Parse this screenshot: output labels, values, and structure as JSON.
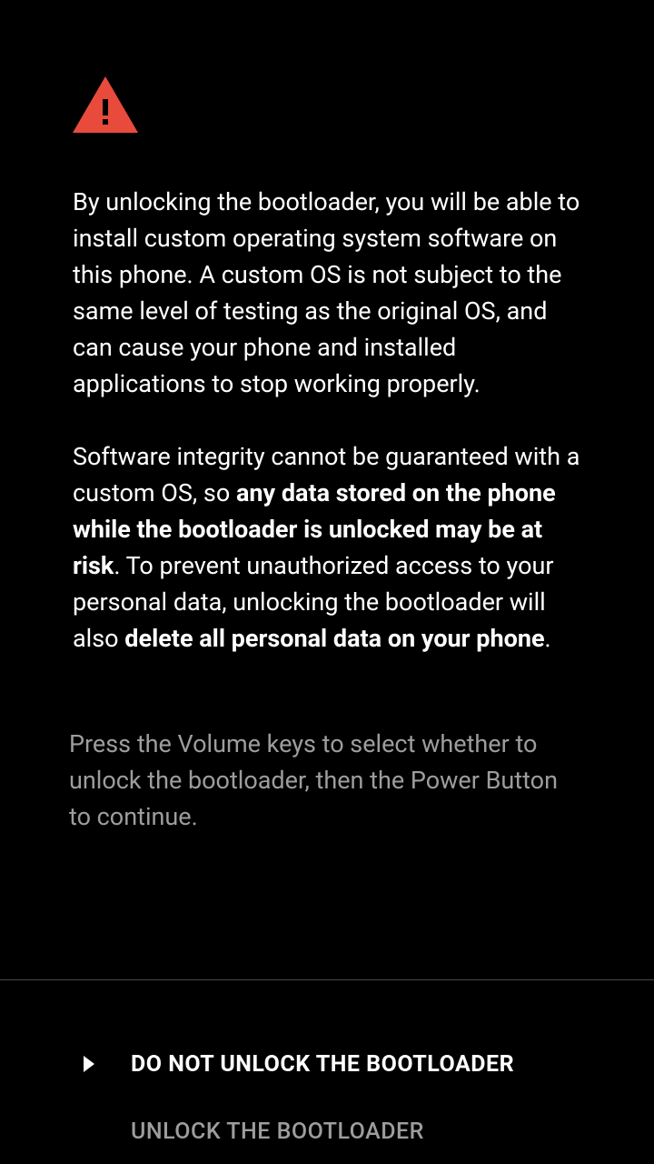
{
  "warning": {
    "paragraph1": "By unlocking the bootloader, you will be able to install custom operating system software on this phone. A custom OS is not subject to the same level of testing as the original OS, and can cause your phone and installed applications to stop working properly.",
    "paragraph2_prefix": "Software integrity cannot be guaranteed with a custom OS, so ",
    "paragraph2_bold1": "any data stored on the phone while the bootloader is unlocked may be at risk",
    "paragraph2_middle": ". To prevent unauthorized access to your personal data, unlocking the bootloader will also ",
    "paragraph2_bold2": "delete all personal data on your phone",
    "paragraph2_suffix": "."
  },
  "instruction": "Press the Volume keys to select whether to unlock the bootloader, then the Power Button to continue.",
  "options": {
    "do_not_unlock": "DO NOT UNLOCK THE BOOTLOADER",
    "unlock": "UNLOCK THE BOOTLOADER"
  }
}
